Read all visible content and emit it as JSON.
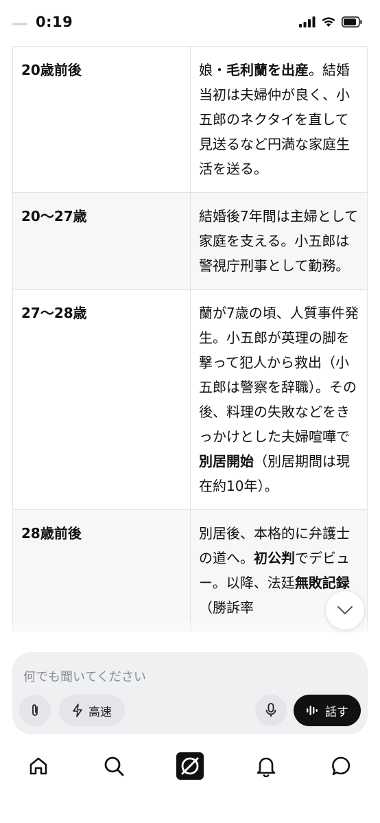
{
  "status_bar": {
    "time": "0:19"
  },
  "table": {
    "rows": [
      {
        "age": "20歳前後",
        "desc": [
          {
            "text": "娘・",
            "bold": false
          },
          {
            "text": "毛利蘭を出産",
            "bold": true
          },
          {
            "text": "。結婚当初は夫婦仲が良く、小五郎のネクタイを直して見送るなど円満な家庭生活を送る。",
            "bold": false
          }
        ]
      },
      {
        "age": "20〜27歳",
        "desc": [
          {
            "text": "結婚後7年間は主婦として家庭を支える。小五郎は警視庁刑事として勤務。",
            "bold": false
          }
        ]
      },
      {
        "age": "27〜28歳",
        "desc": [
          {
            "text": "蘭が7歳の頃、人質事件発生。小五郎が英理の脚を撃って犯人から救出（小五郎は警察を辞職）。その後、料理の失敗などをきっかけとした夫婦喧嘩で",
            "bold": false
          },
          {
            "text": "別居開始",
            "bold": true
          },
          {
            "text": "（別居期間は現在約10年）。",
            "bold": false
          }
        ]
      },
      {
        "age": "28歳前後",
        "desc": [
          {
            "text": "別居後、本格的に弁護士の道へ。",
            "bold": false
          },
          {
            "text": "初公判",
            "bold": true
          },
          {
            "text": "でデビュー。以降、法廷",
            "bold": false
          },
          {
            "text": "無敗記録",
            "bold": true
          },
          {
            "text": "（勝訴率",
            "bold": false
          }
        ]
      }
    ]
  },
  "composer": {
    "placeholder": "何でも聞いてください",
    "speed_label": "高速",
    "talk_label": "話す"
  },
  "colors": {
    "talk_button_bg": "#111111",
    "composer_bg": "#eef0f2"
  }
}
